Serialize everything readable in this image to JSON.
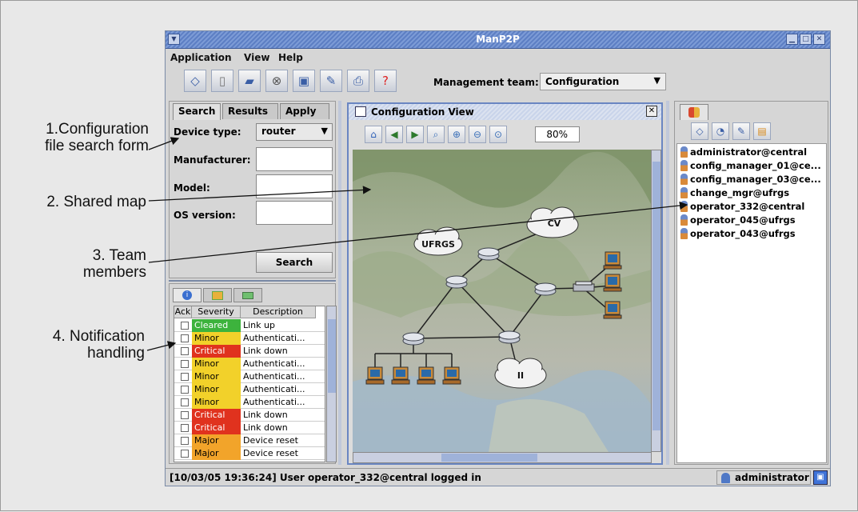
{
  "callouts": {
    "c1": "1.Configuration file search form",
    "c2": "2. Shared map",
    "c3": "3. Team members",
    "c4": "4. Notification handling"
  },
  "window": {
    "title": "ManP2P",
    "system_icon": "menu-icon",
    "controls": [
      "minimize-icon",
      "maximize-icon",
      "close-icon"
    ]
  },
  "menubar": {
    "items": [
      "Application",
      "View",
      "Help"
    ]
  },
  "toolbar": {
    "icons": [
      "tag-icon",
      "new-document-icon",
      "open-folder-icon",
      "stop-icon",
      "save-icon",
      "edit-icon",
      "print-icon",
      "help-icon"
    ],
    "management_label": "Management team:",
    "management_value": "Configuration"
  },
  "search_panel": {
    "tabs": [
      "Search",
      "Results",
      "Apply"
    ],
    "active_tab": "Search",
    "device_type_label": "Device type:",
    "device_type_value": "router",
    "manufacturer_label": "Manufacturer:",
    "manufacturer_value": "",
    "model_label": "Model:",
    "model_value": "",
    "os_version_label": "OS version:",
    "os_version_value": "",
    "search_button": "Search"
  },
  "notifications": {
    "tabs": [
      "info-icon",
      "map-icon",
      "message-icon"
    ],
    "columns": [
      "Ack",
      "Severity",
      "Description"
    ],
    "rows": [
      {
        "severity": "Cleared",
        "description": "Link up",
        "color": "#3db33d"
      },
      {
        "severity": "Minor",
        "description": "Authenticati...",
        "color": "#f2d12a"
      },
      {
        "severity": "Critical",
        "description": "Link down",
        "color": "#e0321e"
      },
      {
        "severity": "Minor",
        "description": "Authenticati...",
        "color": "#f2d12a"
      },
      {
        "severity": "Minor",
        "description": "Authenticati...",
        "color": "#f2d12a"
      },
      {
        "severity": "Minor",
        "description": "Authenticati...",
        "color": "#f2d12a"
      },
      {
        "severity": "Minor",
        "description": "Authenticati...",
        "color": "#f2d12a"
      },
      {
        "severity": "Critical",
        "description": "Link down",
        "color": "#e0321e"
      },
      {
        "severity": "Critical",
        "description": "Link down",
        "color": "#e0321e"
      },
      {
        "severity": "Major",
        "description": "Device reset",
        "color": "#f2a42a"
      },
      {
        "severity": "Major",
        "description": "Device reset",
        "color": "#f2a42a"
      }
    ]
  },
  "config_view": {
    "title": "Configuration View",
    "tool_icons": [
      "home-icon",
      "back-icon",
      "forward-icon",
      "zoom-icon",
      "zoom-in-icon",
      "zoom-out-icon",
      "zoom-fit-icon"
    ],
    "zoom": "80%",
    "clouds": [
      "UFRGS",
      "CV",
      "II"
    ]
  },
  "team_panel": {
    "tab_icon": "team-icon",
    "tool_icons": [
      "chat-icon",
      "talk-icon",
      "note-icon",
      "whiteboard-icon"
    ],
    "members": [
      "administrator@central",
      "config_manager_01@ce...",
      "config_manager_03@ce...",
      "change_mgr@ufrgs",
      "operator_332@central",
      "operator_045@ufrgs",
      "operator_043@ufrgs"
    ]
  },
  "statusbar": {
    "message": "[10/03/05 19:36:24] User operator_332@central logged in",
    "user": "administrator"
  },
  "colors": {
    "accent": "#5d7fc4",
    "window_bg": "#d6d6d6"
  }
}
